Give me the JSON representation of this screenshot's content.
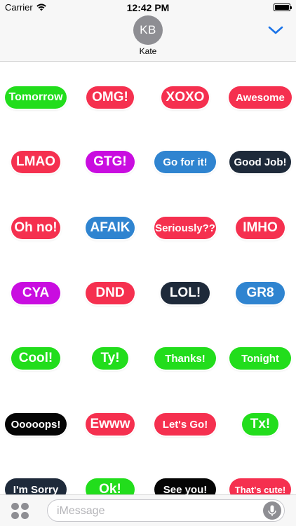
{
  "status_bar": {
    "carrier": "Carrier",
    "time": "12:42 PM"
  },
  "header": {
    "avatar_initials": "KB",
    "contact_name": "Kate"
  },
  "stickers": [
    {
      "label": "Tomorrow",
      "color": "#22dd1c"
    },
    {
      "label": "OMG!",
      "color": "#f5304f"
    },
    {
      "label": "XOXO",
      "color": "#f5304f"
    },
    {
      "label": "Awesome",
      "color": "#f5304f"
    },
    {
      "label": "LMAO",
      "color": "#f5304f"
    },
    {
      "label": "GTG!",
      "color": "#c90de0"
    },
    {
      "label": "Go for it!",
      "color": "#2f84d0"
    },
    {
      "label": "Good Job!",
      "color": "#1e2a3a"
    },
    {
      "label": "Oh no!",
      "color": "#f5304f"
    },
    {
      "label": "AFAIK",
      "color": "#2f84d0"
    },
    {
      "label": "Seriously??",
      "color": "#f5304f"
    },
    {
      "label": "IMHO",
      "color": "#f5304f"
    },
    {
      "label": "CYA",
      "color": "#c90de0"
    },
    {
      "label": "DND",
      "color": "#f5304f"
    },
    {
      "label": "LOL!",
      "color": "#1e2a3a"
    },
    {
      "label": "GR8",
      "color": "#2f84d0"
    },
    {
      "label": "Cool!",
      "color": "#22dd1c"
    },
    {
      "label": "Ty!",
      "color": "#22dd1c"
    },
    {
      "label": "Thanks!",
      "color": "#22dd1c"
    },
    {
      "label": "Tonight",
      "color": "#22dd1c"
    },
    {
      "label": "Ooooops!",
      "color": "#050505"
    },
    {
      "label": "Ewww",
      "color": "#f5304f"
    },
    {
      "label": "Let's Go!",
      "color": "#f5304f"
    },
    {
      "label": "Tx!",
      "color": "#22dd1c"
    },
    {
      "label": "I'm Sorry",
      "color": "#1e2a3a"
    },
    {
      "label": "Ok!",
      "color": "#22dd1c"
    },
    {
      "label": "See you!",
      "color": "#050505"
    },
    {
      "label": "That's cute!",
      "color": "#f5304f"
    }
  ],
  "input_bar": {
    "placeholder": "iMessage",
    "value": ""
  }
}
